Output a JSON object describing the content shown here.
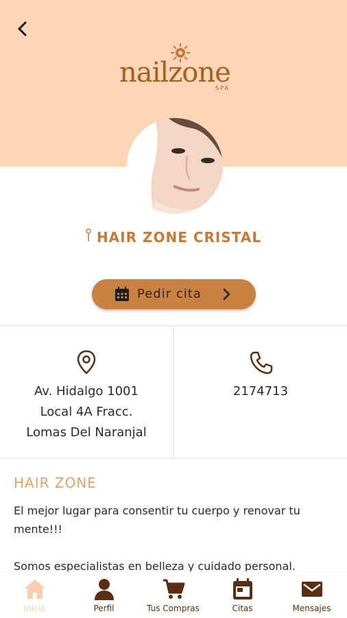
{
  "header": {
    "back_icon": "chevron-left-icon",
    "logo": {
      "text": "nailzone",
      "sub": "SPA"
    }
  },
  "salon": {
    "pin_icon": "pin-icon",
    "name": "HAIR ZONE CRISTAL"
  },
  "cta": {
    "icon": "calendar-icon",
    "label": "Pedir cita",
    "chevron_icon": "chevron-right-icon",
    "color": "#c98142"
  },
  "contact": {
    "address_icon": "location-pin-icon",
    "address_lines": [
      "Av. Hidalgo 1001",
      "Local 4A Fracc.",
      "Lomas Del Naranjal"
    ],
    "phone_icon": "phone-icon",
    "phone": "2174713"
  },
  "about": {
    "title": "HAIR ZONE",
    "paragraphs": [
      "El mejor lugar para consentir tu cuerpo y renovar tu mente!!!",
      "Somos especialistas en belleza y cuidado personal."
    ]
  },
  "tabbar": {
    "items": [
      {
        "label": "Inicio",
        "icon": "home-icon",
        "active": true
      },
      {
        "label": "Perfil",
        "icon": "person-icon",
        "active": false
      },
      {
        "label": "Tus Compras",
        "icon": "cart-icon",
        "active": false
      },
      {
        "label": "Citas",
        "icon": "calendar-icon",
        "active": false
      },
      {
        "label": "Mensajes",
        "icon": "mail-icon",
        "active": false
      }
    ]
  },
  "colors": {
    "header_bg": "#fcd6b6",
    "brand": "#c77a38",
    "tab_active": "#f8cdb0",
    "tab_inactive": "#5b2d12"
  }
}
